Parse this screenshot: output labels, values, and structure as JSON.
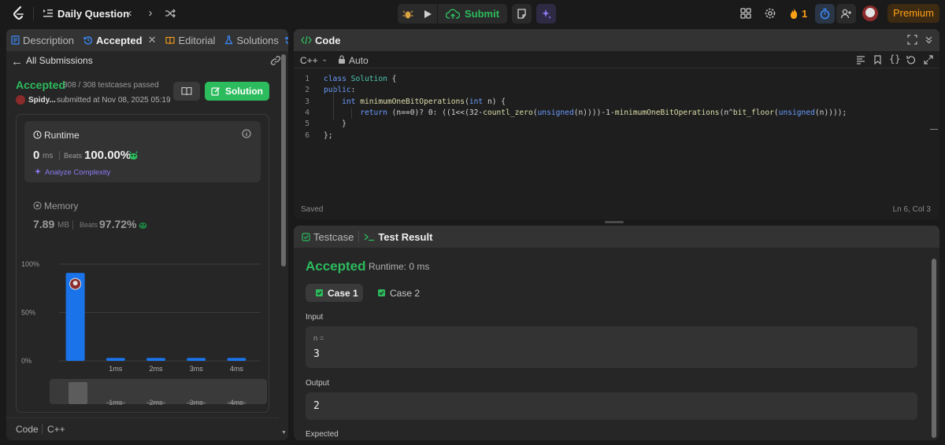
{
  "topbar": {
    "title": "Daily Question",
    "submit_label": "Submit",
    "streak_count": "1",
    "premium_label": "Premium"
  },
  "left_panel": {
    "tabs": [
      {
        "label": "Description"
      },
      {
        "label": "Accepted"
      },
      {
        "label": "Editorial"
      },
      {
        "label": "Solutions"
      }
    ],
    "back_label": "All Submissions",
    "status": "Accepted",
    "testcases": "308 / 308 testcases passed",
    "user": "Spidy...",
    "submitted": "submitted at Nov 08, 2025 05:19",
    "solution_label": "Solution",
    "runtime": {
      "label": "Runtime",
      "value": "0",
      "unit": "ms",
      "beats_label": "Beats",
      "beats_value": "100.00%",
      "analyze_label": "Analyze Complexity"
    },
    "memory": {
      "label": "Memory",
      "value": "7.89",
      "unit": "MB",
      "beats_label": "Beats",
      "beats_value": "97.72%"
    },
    "footer": {
      "code_label": "Code",
      "lang": "C++"
    }
  },
  "chart_data": {
    "type": "bar",
    "y_ticks": [
      "100%",
      "50%",
      "0%"
    ],
    "ylim": [
      0,
      100
    ],
    "categories": [
      "",
      "1ms",
      "2ms",
      "3ms",
      "4ms"
    ],
    "values": [
      91,
      3,
      3,
      3,
      3
    ],
    "highlight_index": 0,
    "bar_color": "#1a73e8",
    "minimap_labels": [
      "1ms",
      "2ms",
      "3ms",
      "4ms"
    ]
  },
  "code_panel": {
    "title": "Code",
    "lang": "C++",
    "mode": "Auto",
    "status": "Saved",
    "cursor": "Ln 6, Col 3",
    "line_numbers": [
      "1",
      "2",
      "3",
      "4",
      "5",
      "6"
    ]
  },
  "result_panel": {
    "tabs": [
      {
        "label": "Testcase"
      },
      {
        "label": "Test Result"
      }
    ],
    "status": "Accepted",
    "runtime": "Runtime: 0 ms",
    "cases": [
      {
        "label": "Case 1"
      },
      {
        "label": "Case 2"
      }
    ],
    "input_label": "Input",
    "input_var": "n =",
    "input_value": "3",
    "output_label": "Output",
    "output_value": "2",
    "expected_label": "Expected"
  },
  "colors": {
    "accent_green": "#2cbb5d",
    "brand_orange": "#ffa116",
    "bar_blue": "#1a73e8"
  }
}
